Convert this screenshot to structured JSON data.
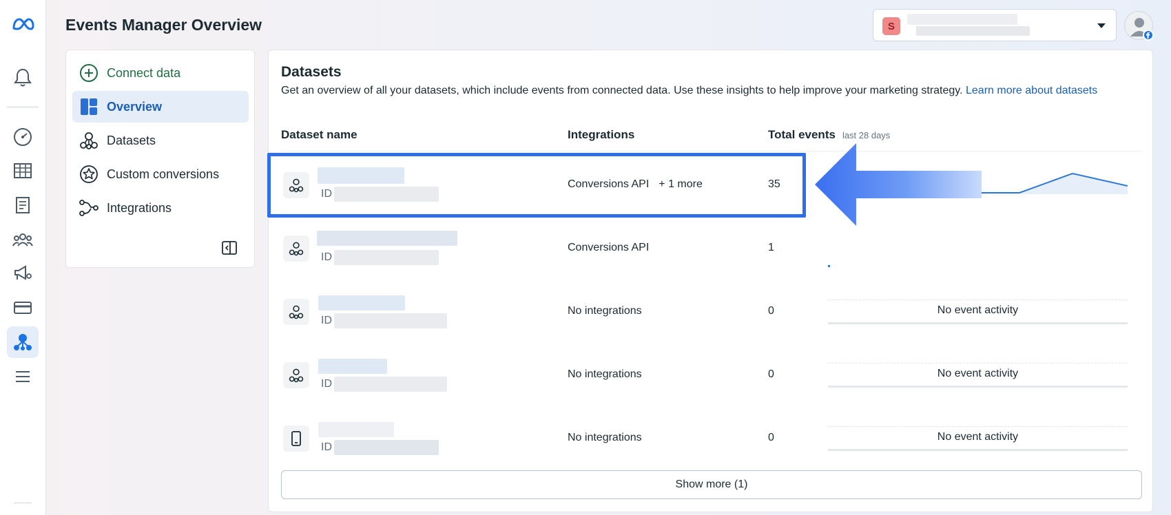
{
  "header": {
    "title": "Events Manager Overview"
  },
  "account": {
    "badge": "S"
  },
  "sidebar": {
    "items": [
      {
        "label": "Connect data"
      },
      {
        "label": "Overview"
      },
      {
        "label": "Datasets"
      },
      {
        "label": "Custom conversions"
      },
      {
        "label": "Integrations"
      }
    ]
  },
  "datasets": {
    "title": "Datasets",
    "description": "Get an overview of all your datasets, which include events from connected data. Use these insights to help improve your marketing strategy.",
    "learn_more": "Learn more about datasets",
    "columns": {
      "name": "Dataset name",
      "integrations": "Integrations",
      "total": "Total events",
      "total_sub": "last 28 days"
    },
    "id_label": "ID",
    "rows": [
      {
        "integrations": "Conversions API",
        "more": "+ 1 more",
        "total": "35"
      },
      {
        "integrations": "Conversions API",
        "more": "",
        "total": "1"
      },
      {
        "integrations": "No integrations",
        "more": "",
        "total": "0",
        "activity": "No event activity"
      },
      {
        "integrations": "No integrations",
        "more": "",
        "total": "0",
        "activity": "No event activity"
      },
      {
        "integrations": "No integrations",
        "more": "",
        "total": "0",
        "activity": "No event activity"
      }
    ],
    "show_more": "Show more (1)"
  },
  "colors": {
    "accent": "#1b74e4",
    "highlight": "#2f6ee8",
    "connect": "#1f6e43"
  }
}
